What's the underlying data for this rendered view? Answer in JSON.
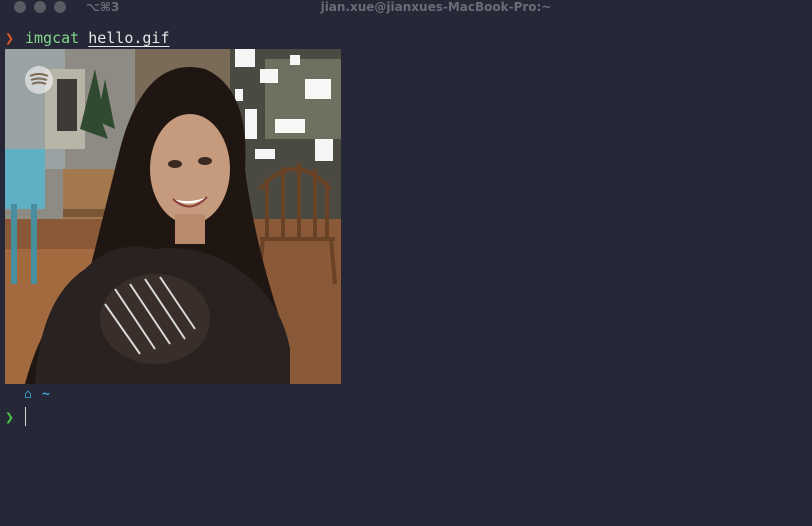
{
  "window": {
    "shortcut": "⌥⌘3",
    "title": "jian.xue@jianxues-MacBook-Pro:~"
  },
  "terminal": {
    "line1": {
      "prompt_symbol": "❯",
      "command": "imgcat",
      "argument": "hello.gif"
    },
    "image": {
      "alt": "hello.gif"
    },
    "line2": {
      "apple_icon": "apple-icon",
      "home_icon": "home-icon",
      "path": "~"
    },
    "line3": {
      "prompt_symbol": "❯"
    }
  },
  "colors": {
    "background": "#262837",
    "prompt_red": "#e0552d",
    "prompt_green": "#4cc34a",
    "command_green": "#7fd88a",
    "path_blue": "#3ea6d6"
  }
}
